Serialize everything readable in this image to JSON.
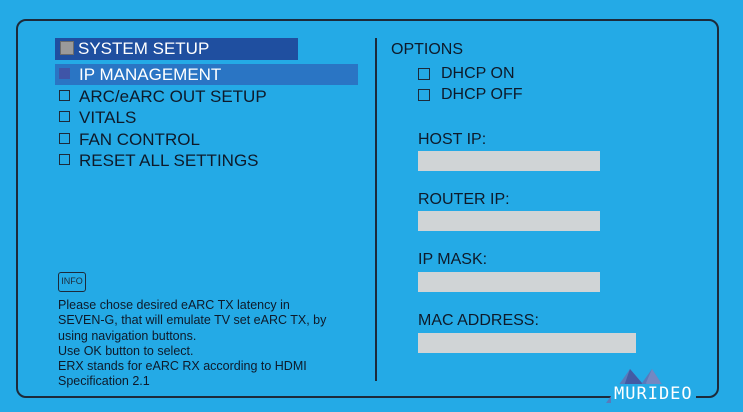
{
  "menu": {
    "title": "SYSTEM SETUP",
    "items": [
      {
        "label": "IP MANAGEMENT",
        "selected": true
      },
      {
        "label": "ARC/eARC OUT SETUP",
        "selected": false
      },
      {
        "label": "VITALS",
        "selected": false
      },
      {
        "label": "FAN CONTROL",
        "selected": false
      },
      {
        "label": "RESET ALL SETTINGS",
        "selected": false
      }
    ]
  },
  "info": {
    "button_label": "INFO",
    "lines": [
      "Please chose desired eARC TX latency in",
      "SEVEN-G, that will emulate TV set eARC TX, by",
      "using navigation buttons.",
      "Use OK button to select.",
      "ERX stands for eARC RX according to HDMI",
      "Specification 2.1"
    ]
  },
  "options": {
    "title": "OPTIONS",
    "dhcp_on": "DHCP ON",
    "dhcp_off": "DHCP OFF",
    "host_ip_label": "HOST IP:",
    "host_ip_value": "",
    "router_ip_label": "ROUTER IP:",
    "router_ip_value": "",
    "ip_mask_label": "IP MASK:",
    "ip_mask_value": "",
    "mac_label": "MAC ADDRESS:",
    "mac_value": ""
  },
  "brand": {
    "name": "MURIDEO",
    "icon": "mountain-logo-icon"
  },
  "colors": {
    "background": "#24aae6",
    "title_bar": "#1f4fa0",
    "selected_row": "#2a75c4",
    "field": "#d0d4d6",
    "frame": "#1d2a3a"
  }
}
